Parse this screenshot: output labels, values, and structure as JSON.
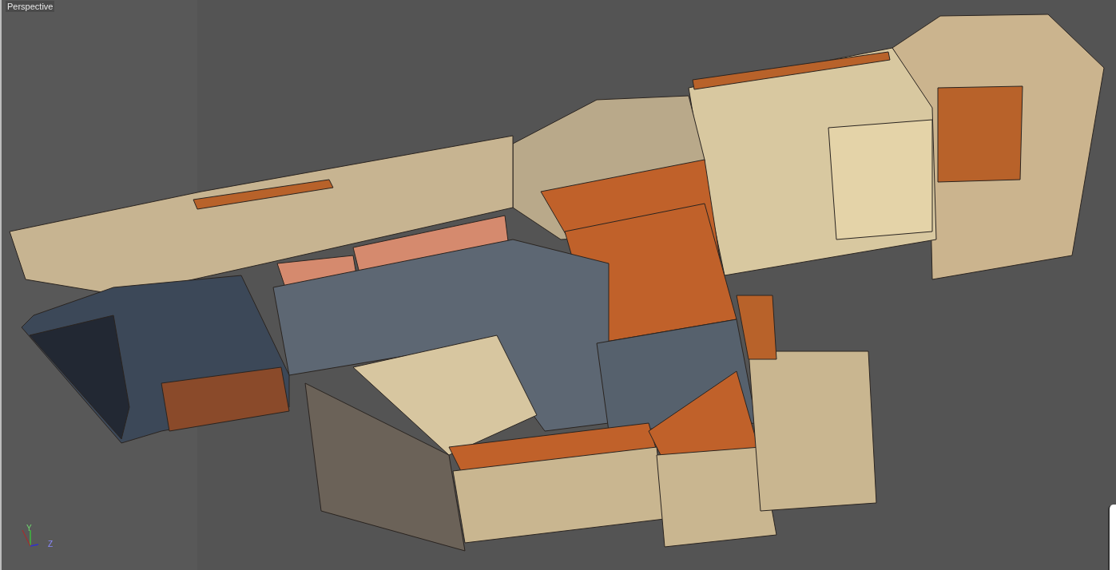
{
  "viewport": {
    "label": "Perspective"
  },
  "axis_gizmo": {
    "y_label": "Y",
    "z_label": "Z"
  }
}
